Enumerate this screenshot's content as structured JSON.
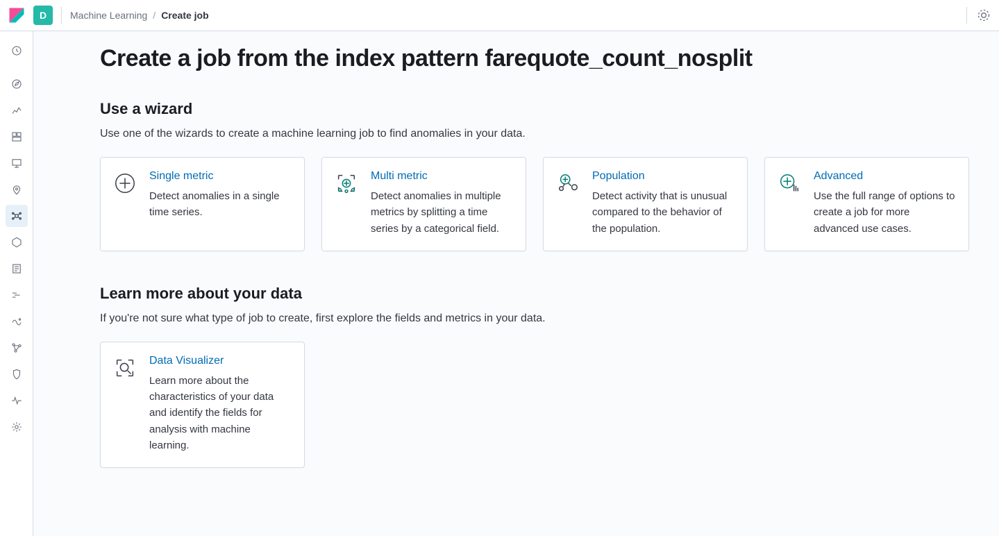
{
  "header": {
    "space_initial": "D",
    "breadcrumbs": {
      "parent": "Machine Learning",
      "separator": "/",
      "current": "Create job"
    }
  },
  "sidebar": {
    "items": [
      {
        "name": "recent-icon"
      },
      {
        "name": "discover-icon"
      },
      {
        "name": "visualize-icon"
      },
      {
        "name": "dashboard-icon"
      },
      {
        "name": "canvas-icon"
      },
      {
        "name": "maps-icon"
      },
      {
        "name": "machine-learning-icon"
      },
      {
        "name": "infrastructure-icon"
      },
      {
        "name": "logs-icon"
      },
      {
        "name": "apm-icon"
      },
      {
        "name": "uptime-icon"
      },
      {
        "name": "graph-icon"
      },
      {
        "name": "siem-icon"
      },
      {
        "name": "monitoring-icon"
      },
      {
        "name": "management-icon"
      }
    ],
    "active_index": 6
  },
  "page": {
    "title": "Create a job from the index pattern farequote_count_nosplit",
    "sections": {
      "wizard": {
        "title": "Use a wizard",
        "description": "Use one of the wizards to create a machine learning job to find anomalies in your data.",
        "cards": [
          {
            "title": "Single metric",
            "description": "Detect anomalies in a single time series."
          },
          {
            "title": "Multi metric",
            "description": "Detect anomalies in multiple metrics by splitting a time series by a categorical field."
          },
          {
            "title": "Population",
            "description": "Detect activity that is unusual compared to the behavior of the population."
          },
          {
            "title": "Advanced",
            "description": "Use the full range of options to create a job for more advanced use cases."
          }
        ]
      },
      "learn": {
        "title": "Learn more about your data",
        "description": "If you're not sure what type of job to create, first explore the fields and metrics in your data.",
        "cards": [
          {
            "title": "Data Visualizer",
            "description": "Learn more about the characteristics of your data and identify the fields for analysis with machine learning."
          }
        ]
      }
    }
  }
}
